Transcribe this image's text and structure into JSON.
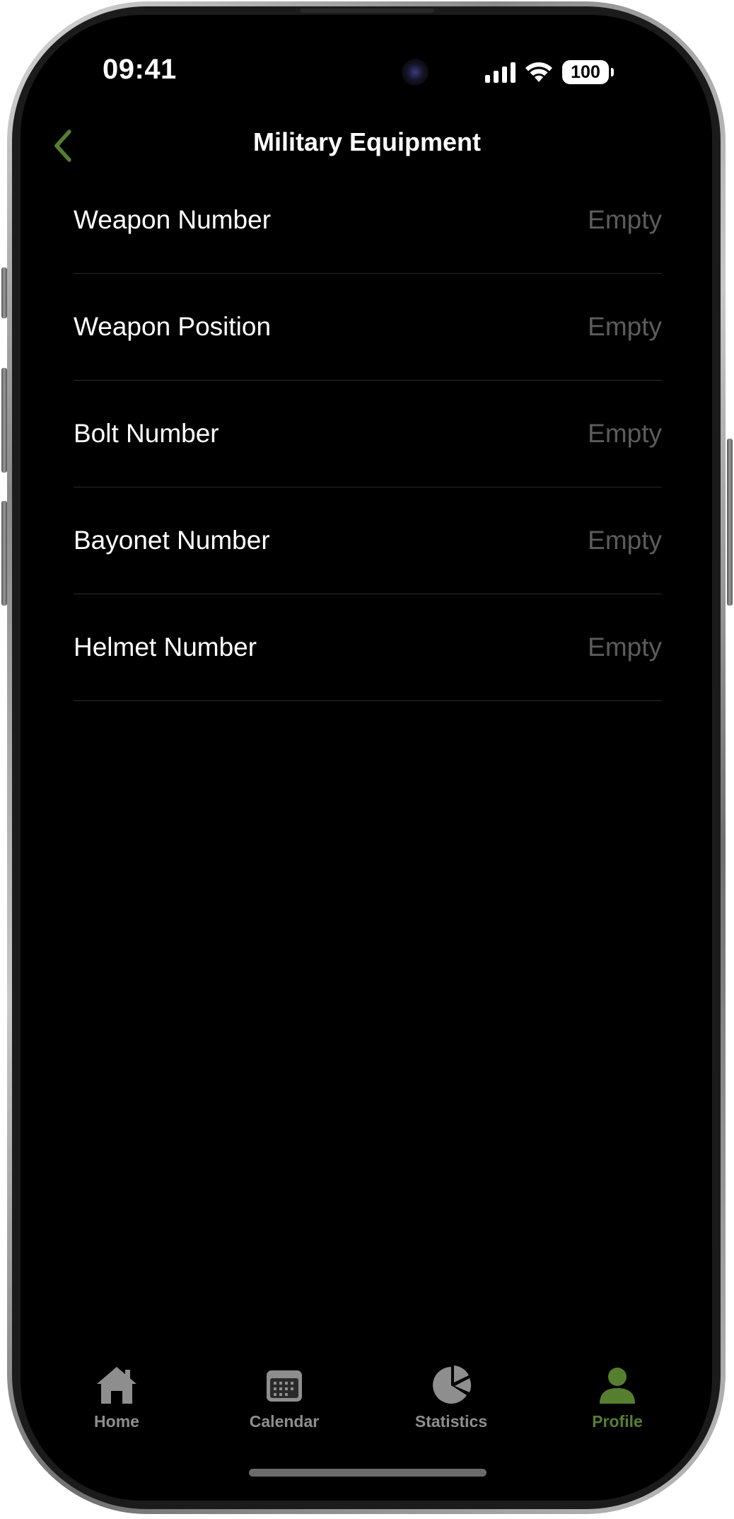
{
  "status_bar": {
    "time": "09:41",
    "battery_level": "100",
    "icons": [
      "cellular-signal-icon",
      "wifi-icon",
      "battery-icon"
    ]
  },
  "nav": {
    "title": "Military Equipment",
    "back_icon": "chevron-left-icon"
  },
  "fields": [
    {
      "label": "Weapon Number",
      "value": "Empty"
    },
    {
      "label": "Weapon Position",
      "value": "Empty"
    },
    {
      "label": "Bolt Number",
      "value": "Empty"
    },
    {
      "label": "Bayonet Number",
      "value": "Empty"
    },
    {
      "label": "Helmet Number",
      "value": "Empty"
    }
  ],
  "tabs": [
    {
      "label": "Home",
      "icon": "house-icon",
      "active": false
    },
    {
      "label": "Calendar",
      "icon": "calendar-icon",
      "active": false
    },
    {
      "label": "Statistics",
      "icon": "pie-chart-icon",
      "active": false
    },
    {
      "label": "Profile",
      "icon": "person-icon",
      "active": true
    }
  ],
  "colors": {
    "accent": "#557f2f",
    "background": "#000000",
    "inactive_tab": "#8e8e8e",
    "placeholder_value": "#5c5c5c"
  }
}
